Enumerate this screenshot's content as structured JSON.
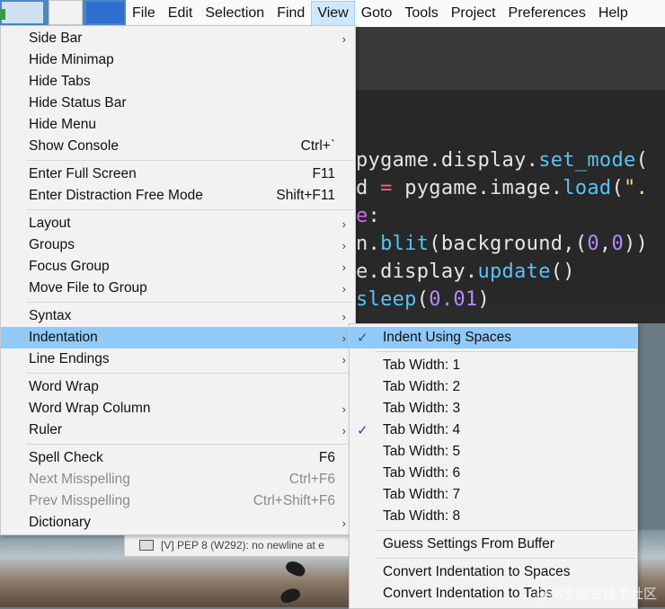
{
  "menubar": {
    "items": [
      "File",
      "Edit",
      "Selection",
      "Find",
      "View",
      "Goto",
      "Tools",
      "Project",
      "Preferences",
      "Help"
    ],
    "active": "View"
  },
  "editor": {
    "lines": [
      [
        "pygame",
        ".",
        "display",
        ".",
        "set_mode",
        "("
      ],
      [
        "d ",
        "= ",
        "pygame",
        ".",
        "image",
        ".",
        "load",
        "(",
        "\"."
      ],
      [
        "e",
        ":"
      ],
      [
        "n",
        ".",
        "blit",
        "(",
        "background",
        ",(",
        "0",
        ",",
        "0",
        "))"
      ],
      [
        "e",
        ".",
        "display",
        ".",
        "update",
        "()"
      ],
      [
        "sleep",
        "(",
        "0.01",
        ")"
      ]
    ]
  },
  "view_menu": {
    "items": [
      {
        "label": "Side Bar",
        "shortcut": "",
        "submenu": true
      },
      {
        "label": "Hide Minimap",
        "shortcut": ""
      },
      {
        "label": "Hide Tabs",
        "shortcut": ""
      },
      {
        "label": "Hide Status Bar",
        "shortcut": ""
      },
      {
        "label": "Hide Menu",
        "shortcut": ""
      },
      {
        "label": "Show Console",
        "shortcut": "Ctrl+`"
      },
      {
        "label": "Enter Full Screen",
        "shortcut": "F11"
      },
      {
        "label": "Enter Distraction Free Mode",
        "shortcut": "Shift+F11"
      },
      {
        "label": "Layout",
        "shortcut": "",
        "submenu": true
      },
      {
        "label": "Groups",
        "shortcut": "",
        "submenu": true
      },
      {
        "label": "Focus Group",
        "shortcut": "",
        "submenu": true
      },
      {
        "label": "Move File to Group",
        "shortcut": "",
        "submenu": true
      },
      {
        "label": "Syntax",
        "shortcut": "",
        "submenu": true
      },
      {
        "label": "Indentation",
        "shortcut": "",
        "submenu": true,
        "highlighted": true
      },
      {
        "label": "Line Endings",
        "shortcut": "",
        "submenu": true
      },
      {
        "label": "Word Wrap",
        "shortcut": ""
      },
      {
        "label": "Word Wrap Column",
        "shortcut": "",
        "submenu": true
      },
      {
        "label": "Ruler",
        "shortcut": "",
        "submenu": true
      },
      {
        "label": "Spell Check",
        "shortcut": "F6"
      },
      {
        "label": "Next Misspelling",
        "shortcut": "Ctrl+F6",
        "disabled": true
      },
      {
        "label": "Prev Misspelling",
        "shortcut": "Ctrl+Shift+F6",
        "disabled": true
      },
      {
        "label": "Dictionary",
        "shortcut": "",
        "submenu": true
      }
    ]
  },
  "indentation_menu": {
    "items": [
      {
        "label": "Indent Using Spaces",
        "checked": true,
        "highlighted": true
      },
      {
        "label": "Tab Width: 1"
      },
      {
        "label": "Tab Width: 2"
      },
      {
        "label": "Tab Width: 3"
      },
      {
        "label": "Tab Width: 4",
        "checked": true
      },
      {
        "label": "Tab Width: 5"
      },
      {
        "label": "Tab Width: 6"
      },
      {
        "label": "Tab Width: 7"
      },
      {
        "label": "Tab Width: 8"
      },
      {
        "label": "Guess Settings From Buffer"
      },
      {
        "label": "Convert Indentation to Spaces"
      },
      {
        "label": "Convert Indentation to Tabs"
      }
    ]
  },
  "status": {
    "text": "[V] PEP 8 (W292): no newline at e"
  },
  "watermark": "@稀土掘金技术社区",
  "icons": {
    "submenu_arrow": "›",
    "check": "✓"
  }
}
